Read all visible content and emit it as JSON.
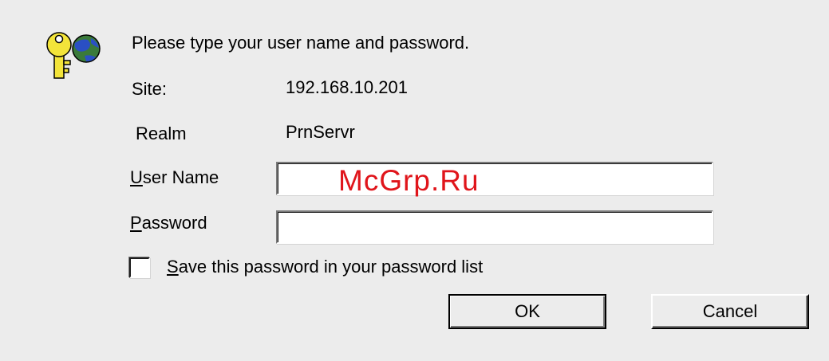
{
  "dialog": {
    "icon": "key-globe-icon",
    "prompt": "Please type your user name and password.",
    "site": {
      "label": "Site:",
      "value": "192.168.10.201"
    },
    "realm": {
      "label": "Realm",
      "value": "PrnServr"
    },
    "user_name": {
      "label_mnemonic": "U",
      "label_rest": "ser Name",
      "value": ""
    },
    "password": {
      "label_mnemonic": "P",
      "label_rest": "assword",
      "value": ""
    },
    "save_password": {
      "label_mnemonic": "S",
      "label_rest": "ave this password in your password list",
      "checked": false
    },
    "ok_label": "OK",
    "cancel_label": "Cancel"
  },
  "watermark": "McGrp.Ru"
}
